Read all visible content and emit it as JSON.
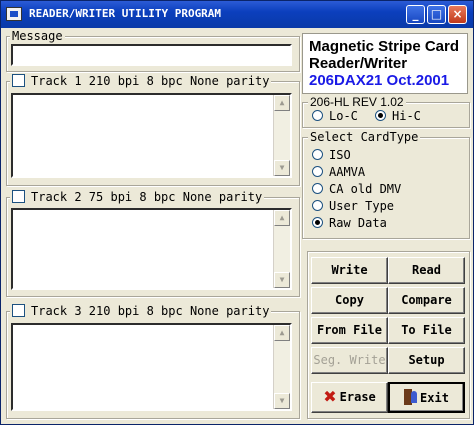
{
  "window": {
    "title": "READER/WRITER UTILITY PROGRAM"
  },
  "title_buttons": {
    "minimize": "_",
    "maximize": "□",
    "close": "×"
  },
  "message": {
    "label": "Message",
    "value": ""
  },
  "tracks": [
    {
      "label": "Track 1  210 bpi  8 bpc  None parity",
      "checked": false,
      "value": ""
    },
    {
      "label": "Track 2  75 bpi  8 bpc  None parity",
      "checked": false,
      "value": ""
    },
    {
      "label": "Track 3  210 bpi  8 bpc  None parity",
      "checked": false,
      "value": ""
    }
  ],
  "info": {
    "line1": "Magnetic Stripe Card",
    "line2": "Reader/Writer",
    "line3": "206DAX21 Oct.2001",
    "line3_color": "#1a1ae6"
  },
  "coercivity": {
    "label": "206-HL REV 1.02",
    "options": [
      "Lo-C",
      "Hi-C"
    ],
    "selected": "Hi-C"
  },
  "card_type": {
    "label": "Select CardType",
    "options": [
      "ISO",
      "AAMVA",
      "CA old DMV",
      "User Type",
      "Raw Data"
    ],
    "selected": "Raw Data"
  },
  "buttons": {
    "write": "Write",
    "read": "Read",
    "copy": "Copy",
    "compare": "Compare",
    "from_file": "From File",
    "to_file": "To File",
    "seg_write": "Seg. Write",
    "setup": "Setup",
    "erase": "Erase",
    "exit": "Exit"
  },
  "icons": {
    "erase": "x-icon",
    "exit": "exit-door-icon"
  }
}
